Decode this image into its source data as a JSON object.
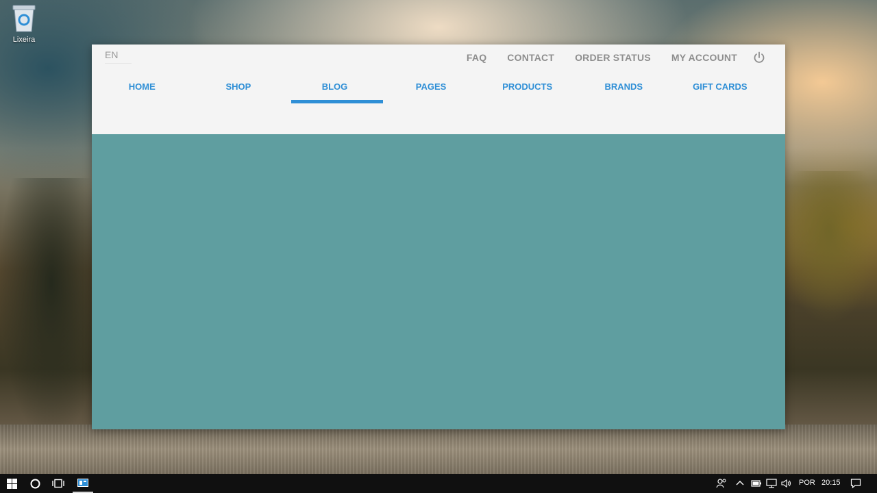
{
  "desktop": {
    "icons": [
      {
        "label": "Lixeira",
        "icon": "recycle-bin-icon"
      }
    ]
  },
  "app": {
    "language": "EN",
    "top_links": [
      "FAQ",
      "CONTACT",
      "ORDER STATUS",
      "MY ACCOUNT"
    ],
    "power_icon": "power-icon",
    "nav": {
      "items": [
        "HOME",
        "SHOP",
        "BLOG",
        "PAGES",
        "PRODUCTS",
        "BRANDS",
        "GIFT CARDS"
      ],
      "active": "BLOG"
    },
    "colors": {
      "accent": "#2f8fd6",
      "header_bg": "#f4f4f4",
      "content_bg": "#5f9ea0",
      "top_link": "#8e8e8e"
    }
  },
  "taskbar": {
    "icons": [
      "windows-start-icon",
      "cortana-search-icon",
      "task-view-icon",
      "app-window-icon"
    ],
    "tray": {
      "icons": [
        "people-icon",
        "chevron-up-icon",
        "battery-icon",
        "network-icon",
        "volume-icon",
        "notification-icon"
      ],
      "language": "POR",
      "time": "20:15"
    }
  }
}
